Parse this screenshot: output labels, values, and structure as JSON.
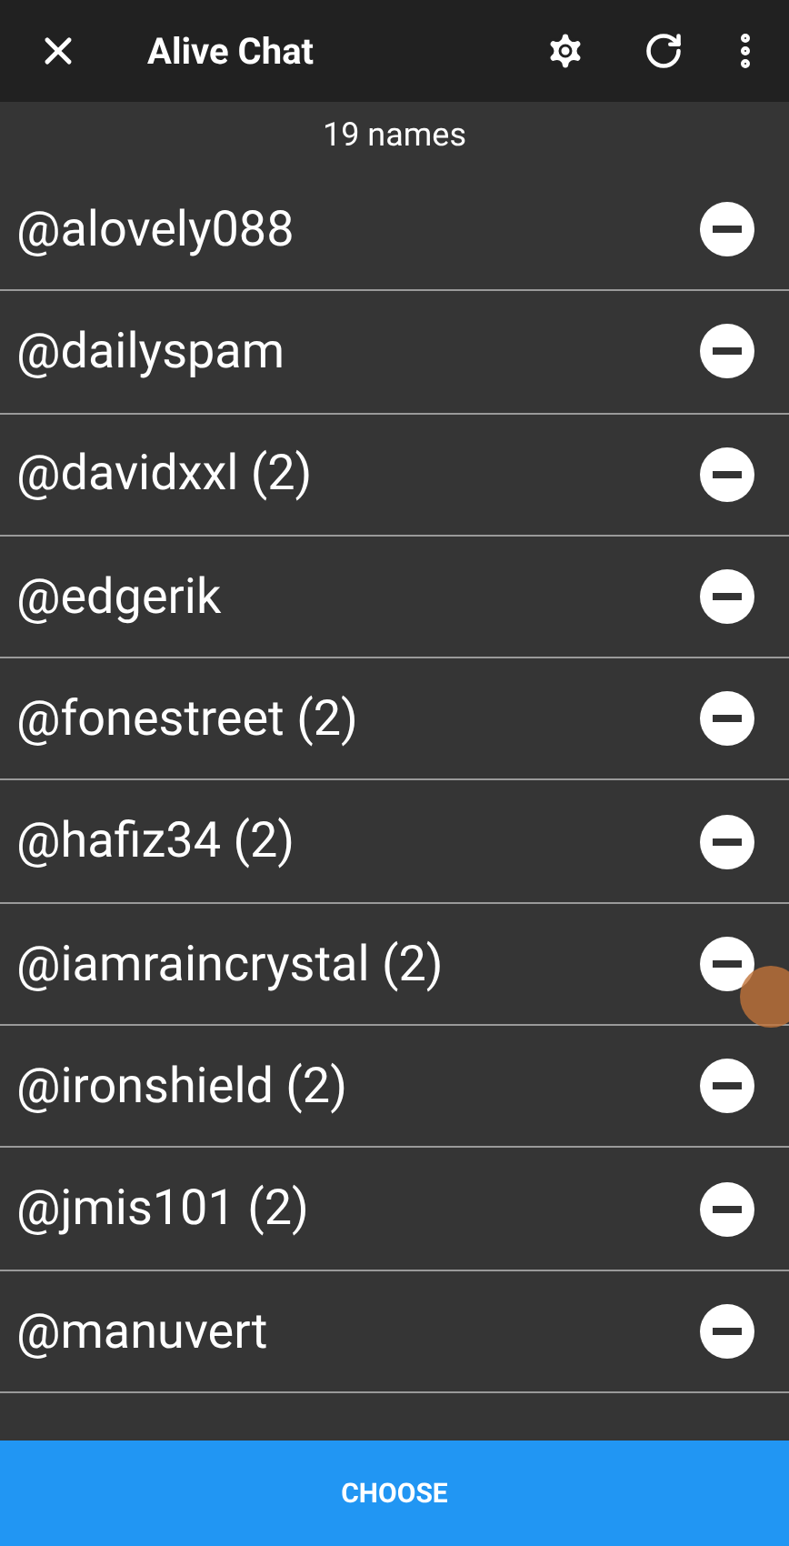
{
  "header": {
    "title": "Alive Chat"
  },
  "count": "19 names",
  "names": [
    {
      "name": "@alovely088"
    },
    {
      "name": "@dailyspam"
    },
    {
      "name": "@davidxxl (2)"
    },
    {
      "name": "@edgerik"
    },
    {
      "name": "@fonestreet (2)"
    },
    {
      "name": "@hafiz34 (2)"
    },
    {
      "name": "@iamraincrystal (2)"
    },
    {
      "name": "@ironshield (2)"
    },
    {
      "name": "@jmis101 (2)"
    },
    {
      "name": "@manuvert"
    }
  ],
  "button": "CHOOSE"
}
